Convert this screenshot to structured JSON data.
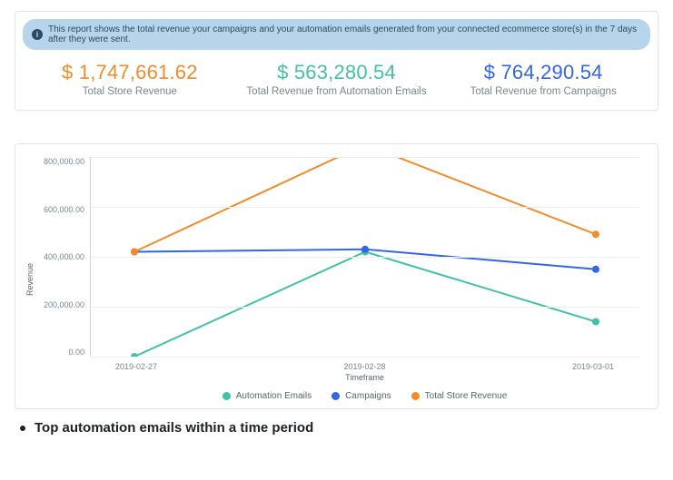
{
  "info": {
    "text": "This report shows the total revenue your campaigns and your automation emails generated from your connected ecommerce store(s) in the 7 days after they were sent.",
    "icon": "i"
  },
  "metrics": [
    {
      "value": "$ 1,747,661.62",
      "label": "Total Store Revenue",
      "color": "#f28c28"
    },
    {
      "value": "$ 563,280.54",
      "label": "Total Revenue from Automation Emails",
      "color": "#42c1a6"
    },
    {
      "value": "$ 764,290.54",
      "label": "Total Revenue from Campaigns",
      "color": "#3366e6"
    }
  ],
  "chart_data": {
    "type": "line",
    "title": "",
    "xlabel": "Timeframe",
    "ylabel": "Revenue",
    "ylim": [
      0,
      800000
    ],
    "yticks": [
      "800,000.00",
      "600,000.00",
      "400,000.00",
      "200,000.00",
      "0.00"
    ],
    "categories": [
      "2019-02-27",
      "2019-02-28",
      "2019-03-01"
    ],
    "series": [
      {
        "name": "Automation Emails",
        "color": "#42c1a6",
        "values": [
          0,
          420000,
          140000
        ]
      },
      {
        "name": "Campaigns",
        "color": "#3366e6",
        "values": [
          420000,
          430000,
          350000
        ]
      },
      {
        "name": "Total Store Revenue",
        "color": "#f28c28",
        "values": [
          420000,
          850000,
          490000
        ]
      }
    ]
  },
  "bullet": {
    "text": "Top automation emails within a time period"
  }
}
